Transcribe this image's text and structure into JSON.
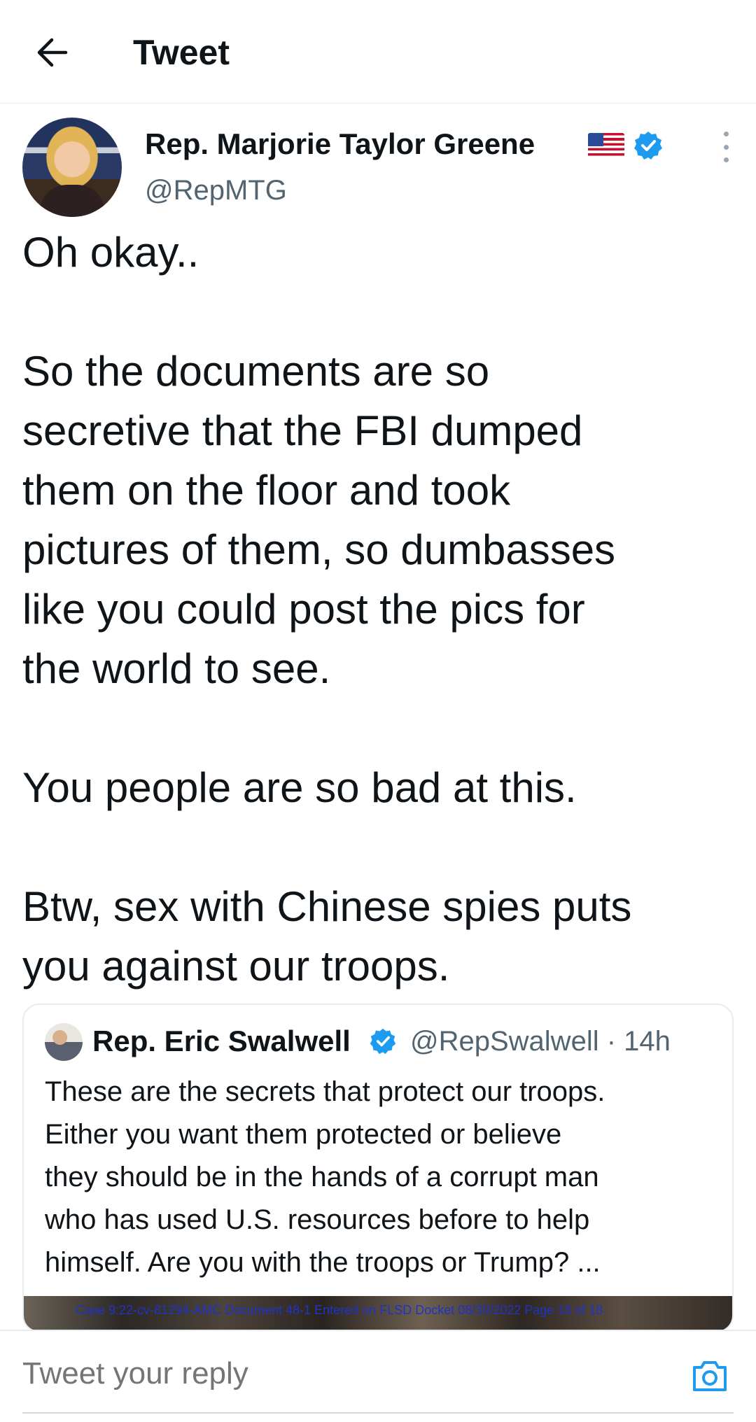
{
  "header": {
    "title": "Tweet",
    "back_icon": "arrow-left-icon"
  },
  "tweet": {
    "author_name": "Rep. Marjorie Taylor Greene",
    "author_handle": "@RepMTG",
    "flag_emoji": "us-flag-icon",
    "verified": true,
    "text": "Oh okay..\n\nSo the documents are so\nsecretive that the FBI dumped\nthem on the floor and took\npictures of them, so dumbasses\nlike you could post the pics for\nthe world to see.\n\nYou people are so bad at this.\n\nBtw, sex with Chinese spies puts\nyou against our troops."
  },
  "quoted_tweet": {
    "author_name": "Rep. Eric Swalwell",
    "author_handle": "@RepSwalwell · 14h",
    "verified": true,
    "text_lines": [
      "These are the secrets that protect our troops.",
      "Either you want them protected or believe",
      "they should be in the hands of a corrupt man",
      "who has used U.S. resources before to help",
      "himself. Are you with the troops or Trump? ..."
    ],
    "media_caption": "Case 9:22-cv-81294-AMC   Document 48-1   Entered on FLSD Docket 08/30/2022   Page 18 of 18"
  },
  "reply": {
    "placeholder": "Tweet your reply",
    "camera_icon": "camera-icon"
  },
  "colors": {
    "verified_blue": "#1d9bf0",
    "secondary_text": "#536471",
    "primary_text": "#0f1419",
    "border": "#e6ecf0"
  }
}
